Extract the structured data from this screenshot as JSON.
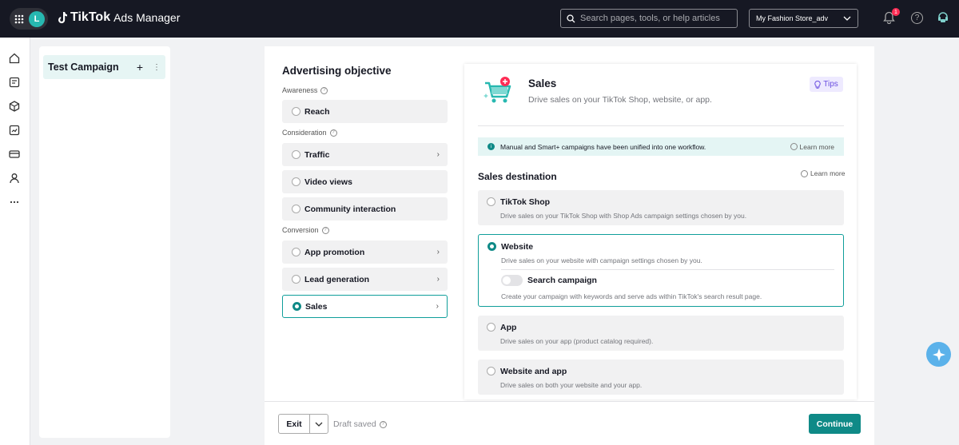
{
  "header": {
    "avatar_letter": "L",
    "logo_brand": "TikTok",
    "logo_product": "Ads Manager",
    "search_placeholder": "Search pages, tools, or help articles",
    "account": "My Fashion Store_adv",
    "notification_count": "1",
    "help_glyph": "?"
  },
  "campaign_panel": {
    "campaign_name": "Test Campaign",
    "add_glyph": "+",
    "more_glyph": "⋮"
  },
  "objective": {
    "title": "Advertising objective",
    "sections": {
      "awareness": "Awareness",
      "consideration": "Consideration",
      "conversion": "Conversion"
    },
    "options": {
      "reach": "Reach",
      "traffic": "Traffic",
      "video_views": "Video views",
      "community": "Community interaction",
      "app_promotion": "App promotion",
      "lead_generation": "Lead generation",
      "sales": "Sales"
    },
    "selected": "Sales"
  },
  "detail": {
    "title": "Sales",
    "subtitle": "Drive sales on your TikTok Shop, website, or app.",
    "tips": "Tips",
    "info_text": "Manual and Smart+ campaigns have been unified into one workflow.",
    "learn_more": "Learn more",
    "destination_title": "Sales destination",
    "destinations": {
      "tiktok_shop": {
        "label": "TikTok Shop",
        "desc": "Drive sales on your TikTok Shop with Shop Ads campaign settings chosen by you."
      },
      "website": {
        "label": "Website",
        "desc": "Drive sales on your website with campaign settings chosen by you."
      },
      "app": {
        "label": "App",
        "desc": "Drive sales on your app (product catalog required)."
      },
      "website_app": {
        "label": "Website and app",
        "desc": "Drive sales on both your website and your app."
      }
    },
    "search_campaign": {
      "label": "Search campaign",
      "desc": "Create your campaign with keywords and serve ads within TikTok's search result page.",
      "enabled": false
    }
  },
  "footer": {
    "exit": "Exit",
    "draft": "Draft saved",
    "continue": "Continue"
  },
  "colors": {
    "accent": "#0f8a87",
    "header_bg": "#161823",
    "badge": "#fe2c55"
  }
}
